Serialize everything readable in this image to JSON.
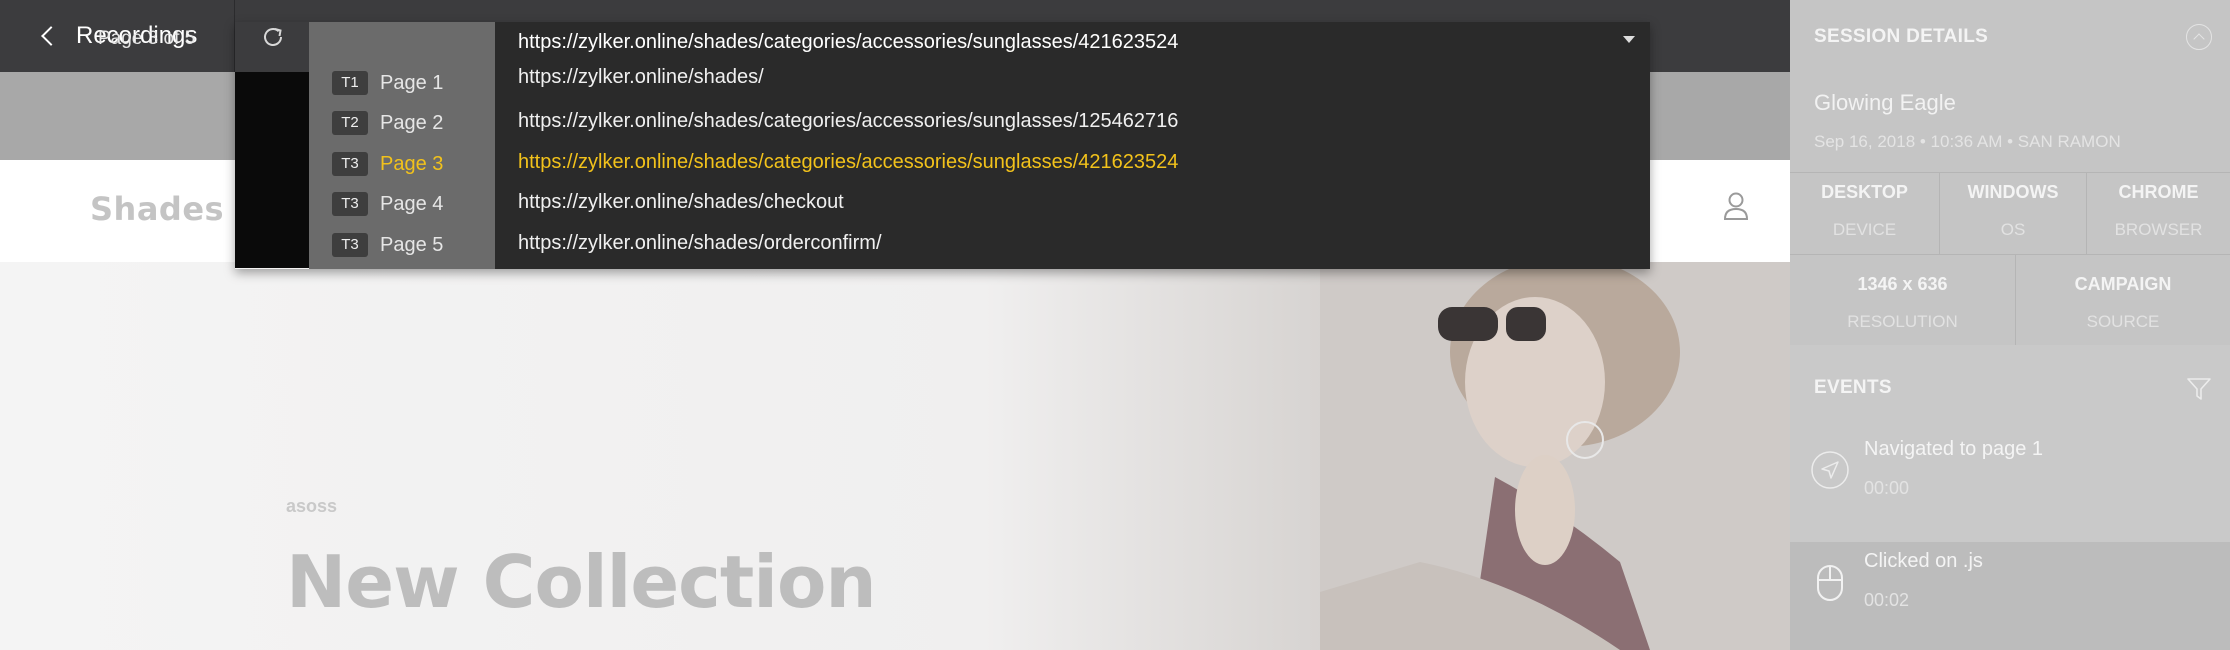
{
  "topbar": {
    "back_label": "Recordings"
  },
  "site": {
    "logo": "Shades",
    "brand_small": "asoss",
    "hero_title": "New Collection"
  },
  "dropdown": {
    "page_indicator": "Page 3 of 5",
    "current_url": "https://zylker.online/shades/categories/accessories/sunglasses/421623524",
    "options": [
      {
        "tab": "T1",
        "page": "Page 1",
        "url": "https://zylker.online/shades/",
        "active": false
      },
      {
        "tab": "T2",
        "page": "Page 2",
        "url": "https://zylker.online/shades/categories/accessories/sunglasses/125462716",
        "active": false
      },
      {
        "tab": "T3",
        "page": "Page 3",
        "url": "https://zylker.online/shades/categories/accessories/sunglasses/421623524",
        "active": true
      },
      {
        "tab": "T3",
        "page": "Page 4",
        "url": "https://zylker.online/shades/checkout",
        "active": false
      },
      {
        "tab": "T3",
        "page": "Page 5",
        "url": "https://zylker.online/shades/orderconfirm/",
        "active": false
      }
    ],
    "active_color": "#f2c21b"
  },
  "panel": {
    "session_header": "SESSION DETAILS",
    "visitor_name": "Glowing Eagle",
    "visitor_meta": "Sep 16, 2018  •  10:36 AM  •  SAN RAMON",
    "stats_row1": [
      {
        "value": "DESKTOP",
        "label": "DEVICE"
      },
      {
        "value": "WINDOWS",
        "label": "OS"
      },
      {
        "value": "CHROME",
        "label": "BROWSER"
      }
    ],
    "stats_row2": [
      {
        "value": "1346 x 636",
        "label": "RESOLUTION"
      },
      {
        "value": "CAMPAIGN",
        "label": "SOURCE"
      }
    ],
    "events_header": "EVENTS",
    "events": [
      {
        "icon": "navigate-icon",
        "title": "Navigated to page 1",
        "time": "00:00"
      },
      {
        "icon": "mouse-click-icon",
        "title": "Clicked on .js",
        "time": "00:02"
      }
    ]
  }
}
